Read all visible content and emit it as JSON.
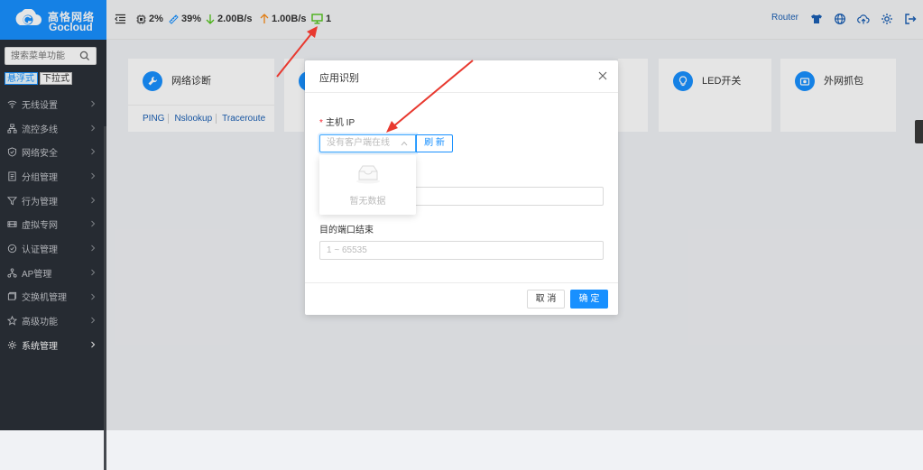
{
  "brand": {
    "cn": "高恪网络",
    "en": "Gocloud",
    "color": "#1890ff"
  },
  "sidebar": {
    "search_placeholder": "搜索菜单功能",
    "modes": [
      "悬浮式",
      "下拉式"
    ],
    "items": [
      {
        "label": "无线设置",
        "icon": "wifi-icon"
      },
      {
        "label": "流控多线",
        "icon": "flow-icon"
      },
      {
        "label": "网络安全",
        "icon": "shield-icon"
      },
      {
        "label": "分组管理",
        "icon": "group-icon"
      },
      {
        "label": "行为管理",
        "icon": "filter-icon"
      },
      {
        "label": "虚拟专网",
        "icon": "vpn-icon"
      },
      {
        "label": "认证管理",
        "icon": "auth-icon"
      },
      {
        "label": "AP管理",
        "icon": "ap-icon"
      },
      {
        "label": "交换机管理",
        "icon": "switch-icon"
      },
      {
        "label": "高级功能",
        "icon": "star-icon"
      },
      {
        "label": "系统管理",
        "icon": "gear-icon"
      }
    ]
  },
  "topbar": {
    "cpu": "2%",
    "mem": "39%",
    "down": "2.00B/s",
    "up": "1.00B/s",
    "clients": "1",
    "router": "Router"
  },
  "cards": [
    {
      "title": "网络诊断",
      "links": [
        "PING",
        "Nslookup",
        "Traceroute"
      ],
      "icon": "wrench-icon"
    },
    {
      "title": "LED开关",
      "icon": "bulb-icon"
    },
    {
      "title": "外网抓包",
      "icon": "capture-icon"
    }
  ],
  "modal": {
    "title": "应用识别",
    "host_ip_label": "主机 IP",
    "select_placeholder": "没有客户端在线",
    "refresh_label": "刷 新",
    "port_end_label": "目的端口结束",
    "port_placeholder": "1 ~ 65535",
    "cancel_label": "取 消",
    "ok_label": "确 定"
  },
  "dropdown": {
    "empty_text": "暂无数据"
  },
  "colors": {
    "primary": "#1890ff",
    "arrow": "#e8392f",
    "sidebar_bg": "#2b3038"
  }
}
